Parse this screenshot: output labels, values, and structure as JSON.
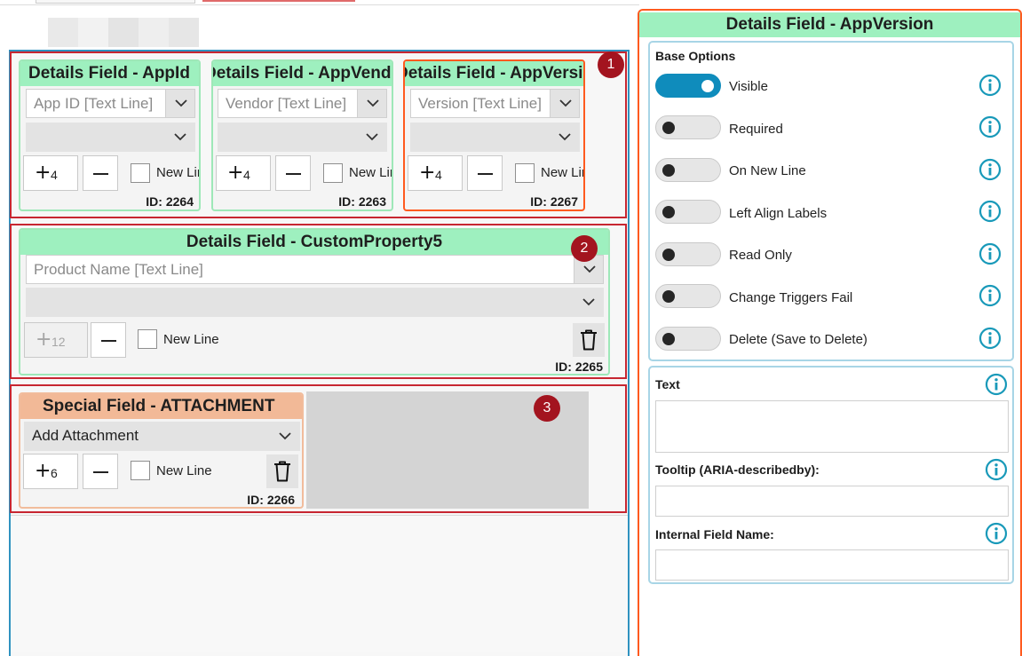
{
  "palette": {
    "canvas_border": "#2f92c0",
    "highlight_box": "#c72631",
    "badge": "#a3141f",
    "details_header": "#9ef0bf",
    "special_header": "#f2b997",
    "selected_border": "#ff5a1f",
    "toggle_on": "#0f8cbc",
    "info_icon": "#1899b9"
  },
  "badges": [
    "1",
    "2",
    "3"
  ],
  "fields": [
    {
      "title": "Details Field - AppId",
      "dropdown": "App ID [Text Line]",
      "stepper": "4",
      "new_line": "New Line",
      "id": "ID: 2264"
    },
    {
      "title": "Details Field - AppVendor",
      "dropdown": "Vendor [Text Line]",
      "stepper": "4",
      "new_line": "New Line",
      "id": "ID: 2263"
    },
    {
      "title": "Details Field - AppVersion",
      "dropdown": "Version [Text Line]",
      "stepper": "4",
      "new_line": "New Line",
      "id": "ID: 2267",
      "selected": true
    },
    {
      "title": "Details Field - CustomProperty5",
      "dropdown": "Product Name [Text Line]",
      "stepper": "12",
      "new_line": "New Line",
      "id": "ID: 2265"
    },
    {
      "title": "Special Field -  ATTACHMENT",
      "dropdown": "Add Attachment",
      "stepper": "6",
      "new_line": "New Line",
      "id": "ID: 2266"
    }
  ],
  "properties_panel": {
    "title": "Details Field - AppVersion",
    "base_options_label": "Base Options",
    "options": [
      {
        "label": "Visible",
        "on": true
      },
      {
        "label": "Required",
        "on": false
      },
      {
        "label": "On New Line",
        "on": false
      },
      {
        "label": "Left Align Labels",
        "on": false
      },
      {
        "label": "Read Only",
        "on": false
      },
      {
        "label": "Change Triggers Fail",
        "on": false
      },
      {
        "label": "Delete (Save to Delete)",
        "on": false
      }
    ],
    "text_label": "Text",
    "text_value": "",
    "tooltip_label": "Tooltip (ARIA-describedby):",
    "tooltip_value": "",
    "internal_name_label": "Internal Field Name:",
    "internal_name_value": ""
  },
  "icons": {
    "dropdown": "chevron-down-icon",
    "increase": "plus-icon",
    "decrease": "minus-icon",
    "delete": "trash-icon",
    "help": "info-icon"
  }
}
